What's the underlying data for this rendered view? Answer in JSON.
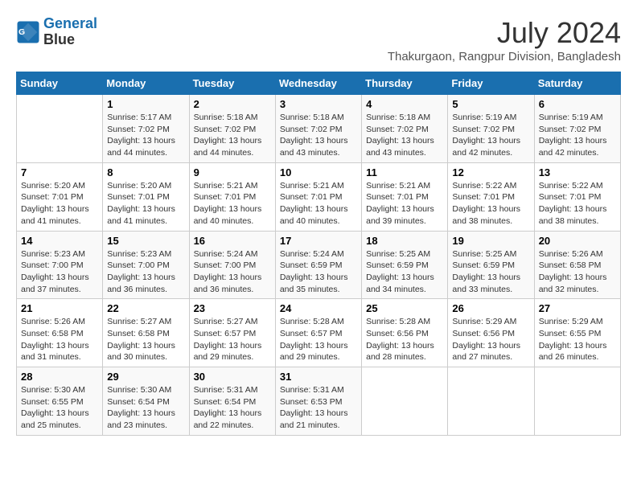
{
  "header": {
    "logo_line1": "General",
    "logo_line2": "Blue",
    "month_title": "July 2024",
    "location": "Thakurgaon, Rangpur Division, Bangladesh"
  },
  "calendar": {
    "days_of_week": [
      "Sunday",
      "Monday",
      "Tuesday",
      "Wednesday",
      "Thursday",
      "Friday",
      "Saturday"
    ],
    "weeks": [
      [
        {
          "day": "",
          "info": ""
        },
        {
          "day": "1",
          "info": "Sunrise: 5:17 AM\nSunset: 7:02 PM\nDaylight: 13 hours\nand 44 minutes."
        },
        {
          "day": "2",
          "info": "Sunrise: 5:18 AM\nSunset: 7:02 PM\nDaylight: 13 hours\nand 44 minutes."
        },
        {
          "day": "3",
          "info": "Sunrise: 5:18 AM\nSunset: 7:02 PM\nDaylight: 13 hours\nand 43 minutes."
        },
        {
          "day": "4",
          "info": "Sunrise: 5:18 AM\nSunset: 7:02 PM\nDaylight: 13 hours\nand 43 minutes."
        },
        {
          "day": "5",
          "info": "Sunrise: 5:19 AM\nSunset: 7:02 PM\nDaylight: 13 hours\nand 42 minutes."
        },
        {
          "day": "6",
          "info": "Sunrise: 5:19 AM\nSunset: 7:02 PM\nDaylight: 13 hours\nand 42 minutes."
        }
      ],
      [
        {
          "day": "7",
          "info": "Sunrise: 5:20 AM\nSunset: 7:01 PM\nDaylight: 13 hours\nand 41 minutes."
        },
        {
          "day": "8",
          "info": "Sunrise: 5:20 AM\nSunset: 7:01 PM\nDaylight: 13 hours\nand 41 minutes."
        },
        {
          "day": "9",
          "info": "Sunrise: 5:21 AM\nSunset: 7:01 PM\nDaylight: 13 hours\nand 40 minutes."
        },
        {
          "day": "10",
          "info": "Sunrise: 5:21 AM\nSunset: 7:01 PM\nDaylight: 13 hours\nand 40 minutes."
        },
        {
          "day": "11",
          "info": "Sunrise: 5:21 AM\nSunset: 7:01 PM\nDaylight: 13 hours\nand 39 minutes."
        },
        {
          "day": "12",
          "info": "Sunrise: 5:22 AM\nSunset: 7:01 PM\nDaylight: 13 hours\nand 38 minutes."
        },
        {
          "day": "13",
          "info": "Sunrise: 5:22 AM\nSunset: 7:01 PM\nDaylight: 13 hours\nand 38 minutes."
        }
      ],
      [
        {
          "day": "14",
          "info": "Sunrise: 5:23 AM\nSunset: 7:00 PM\nDaylight: 13 hours\nand 37 minutes."
        },
        {
          "day": "15",
          "info": "Sunrise: 5:23 AM\nSunset: 7:00 PM\nDaylight: 13 hours\nand 36 minutes."
        },
        {
          "day": "16",
          "info": "Sunrise: 5:24 AM\nSunset: 7:00 PM\nDaylight: 13 hours\nand 36 minutes."
        },
        {
          "day": "17",
          "info": "Sunrise: 5:24 AM\nSunset: 6:59 PM\nDaylight: 13 hours\nand 35 minutes."
        },
        {
          "day": "18",
          "info": "Sunrise: 5:25 AM\nSunset: 6:59 PM\nDaylight: 13 hours\nand 34 minutes."
        },
        {
          "day": "19",
          "info": "Sunrise: 5:25 AM\nSunset: 6:59 PM\nDaylight: 13 hours\nand 33 minutes."
        },
        {
          "day": "20",
          "info": "Sunrise: 5:26 AM\nSunset: 6:58 PM\nDaylight: 13 hours\nand 32 minutes."
        }
      ],
      [
        {
          "day": "21",
          "info": "Sunrise: 5:26 AM\nSunset: 6:58 PM\nDaylight: 13 hours\nand 31 minutes."
        },
        {
          "day": "22",
          "info": "Sunrise: 5:27 AM\nSunset: 6:58 PM\nDaylight: 13 hours\nand 30 minutes."
        },
        {
          "day": "23",
          "info": "Sunrise: 5:27 AM\nSunset: 6:57 PM\nDaylight: 13 hours\nand 29 minutes."
        },
        {
          "day": "24",
          "info": "Sunrise: 5:28 AM\nSunset: 6:57 PM\nDaylight: 13 hours\nand 29 minutes."
        },
        {
          "day": "25",
          "info": "Sunrise: 5:28 AM\nSunset: 6:56 PM\nDaylight: 13 hours\nand 28 minutes."
        },
        {
          "day": "26",
          "info": "Sunrise: 5:29 AM\nSunset: 6:56 PM\nDaylight: 13 hours\nand 27 minutes."
        },
        {
          "day": "27",
          "info": "Sunrise: 5:29 AM\nSunset: 6:55 PM\nDaylight: 13 hours\nand 26 minutes."
        }
      ],
      [
        {
          "day": "28",
          "info": "Sunrise: 5:30 AM\nSunset: 6:55 PM\nDaylight: 13 hours\nand 25 minutes."
        },
        {
          "day": "29",
          "info": "Sunrise: 5:30 AM\nSunset: 6:54 PM\nDaylight: 13 hours\nand 23 minutes."
        },
        {
          "day": "30",
          "info": "Sunrise: 5:31 AM\nSunset: 6:54 PM\nDaylight: 13 hours\nand 22 minutes."
        },
        {
          "day": "31",
          "info": "Sunrise: 5:31 AM\nSunset: 6:53 PM\nDaylight: 13 hours\nand 21 minutes."
        },
        {
          "day": "",
          "info": ""
        },
        {
          "day": "",
          "info": ""
        },
        {
          "day": "",
          "info": ""
        }
      ]
    ]
  }
}
